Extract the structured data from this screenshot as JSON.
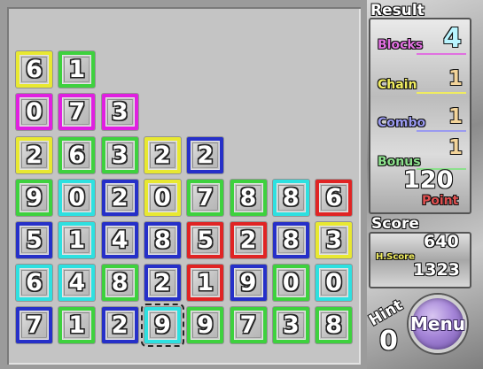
{
  "board": {
    "tiles": [
      {
        "n": "6",
        "c": "#e8e831"
      },
      {
        "n": "1",
        "c": "#3ed13e"
      },
      {
        "n": "0",
        "c": "#e020e0"
      },
      {
        "n": "7",
        "c": "#e020e0"
      },
      {
        "n": "3",
        "c": "#e020e0"
      },
      {
        "n": "2",
        "c": "#e8e831"
      },
      {
        "n": "6",
        "c": "#3ed13e"
      },
      {
        "n": "3",
        "c": "#3ed13e"
      },
      {
        "n": "2",
        "c": "#e8e831"
      },
      {
        "n": "2",
        "c": "#2630c8"
      },
      {
        "n": "9",
        "c": "#3ed13e"
      },
      {
        "n": "0",
        "c": "#2ee0e0"
      },
      {
        "n": "2",
        "c": "#2630c8"
      },
      {
        "n": "0",
        "c": "#e8e831"
      },
      {
        "n": "7",
        "c": "#3ed13e"
      },
      {
        "n": "8",
        "c": "#3ed13e"
      },
      {
        "n": "8",
        "c": "#2ee0e0"
      },
      {
        "n": "6",
        "c": "#e02424"
      },
      {
        "n": "5",
        "c": "#2630c8"
      },
      {
        "n": "1",
        "c": "#2ee0e0"
      },
      {
        "n": "4",
        "c": "#2630c8"
      },
      {
        "n": "8",
        "c": "#2630c8"
      },
      {
        "n": "5",
        "c": "#e02424"
      },
      {
        "n": "2",
        "c": "#e02424"
      },
      {
        "n": "8",
        "c": "#2630c8"
      },
      {
        "n": "3",
        "c": "#e8e831"
      },
      {
        "n": "6",
        "c": "#2ee0e0"
      },
      {
        "n": "4",
        "c": "#2ee0e0"
      },
      {
        "n": "8",
        "c": "#3ed13e"
      },
      {
        "n": "2",
        "c": "#2630c8"
      },
      {
        "n": "1",
        "c": "#e02424"
      },
      {
        "n": "9",
        "c": "#2630c8"
      },
      {
        "n": "0",
        "c": "#3ed13e"
      },
      {
        "n": "0",
        "c": "#2ee0e0"
      },
      {
        "n": "7",
        "c": "#2630c8"
      },
      {
        "n": "1",
        "c": "#3ed13e"
      },
      {
        "n": "2",
        "c": "#2630c8"
      },
      {
        "n": "9",
        "c": "#2ee0e0",
        "selected": true
      },
      {
        "n": "9",
        "c": "#3ed13e"
      },
      {
        "n": "7",
        "c": "#3ed13e"
      },
      {
        "n": "3",
        "c": "#3ed13e"
      },
      {
        "n": "8",
        "c": "#3ed13e"
      }
    ]
  },
  "result": {
    "title": "Result",
    "blocks_label": "Blocks",
    "blocks_value": "4",
    "chain_label": "Chain",
    "chain_value": "1",
    "combo_label": "Combo",
    "combo_value": "1",
    "bonus_label": "Bonus",
    "bonus_value": "1",
    "points_value": "120",
    "point_label": "Point"
  },
  "score": {
    "title": "Score",
    "value": "640",
    "hiscore_label": "H.Score",
    "hiscore_value": "1323"
  },
  "hint": {
    "label": "Hint",
    "count": "0"
  },
  "menu": {
    "label": "Menu"
  },
  "colors": {
    "blocks": "#e070e0",
    "chain": "#f0ec60",
    "combo": "#9a9af0",
    "bonus": "#8ce08c",
    "point": "#e05050",
    "hiscore": "#f0ec60"
  }
}
